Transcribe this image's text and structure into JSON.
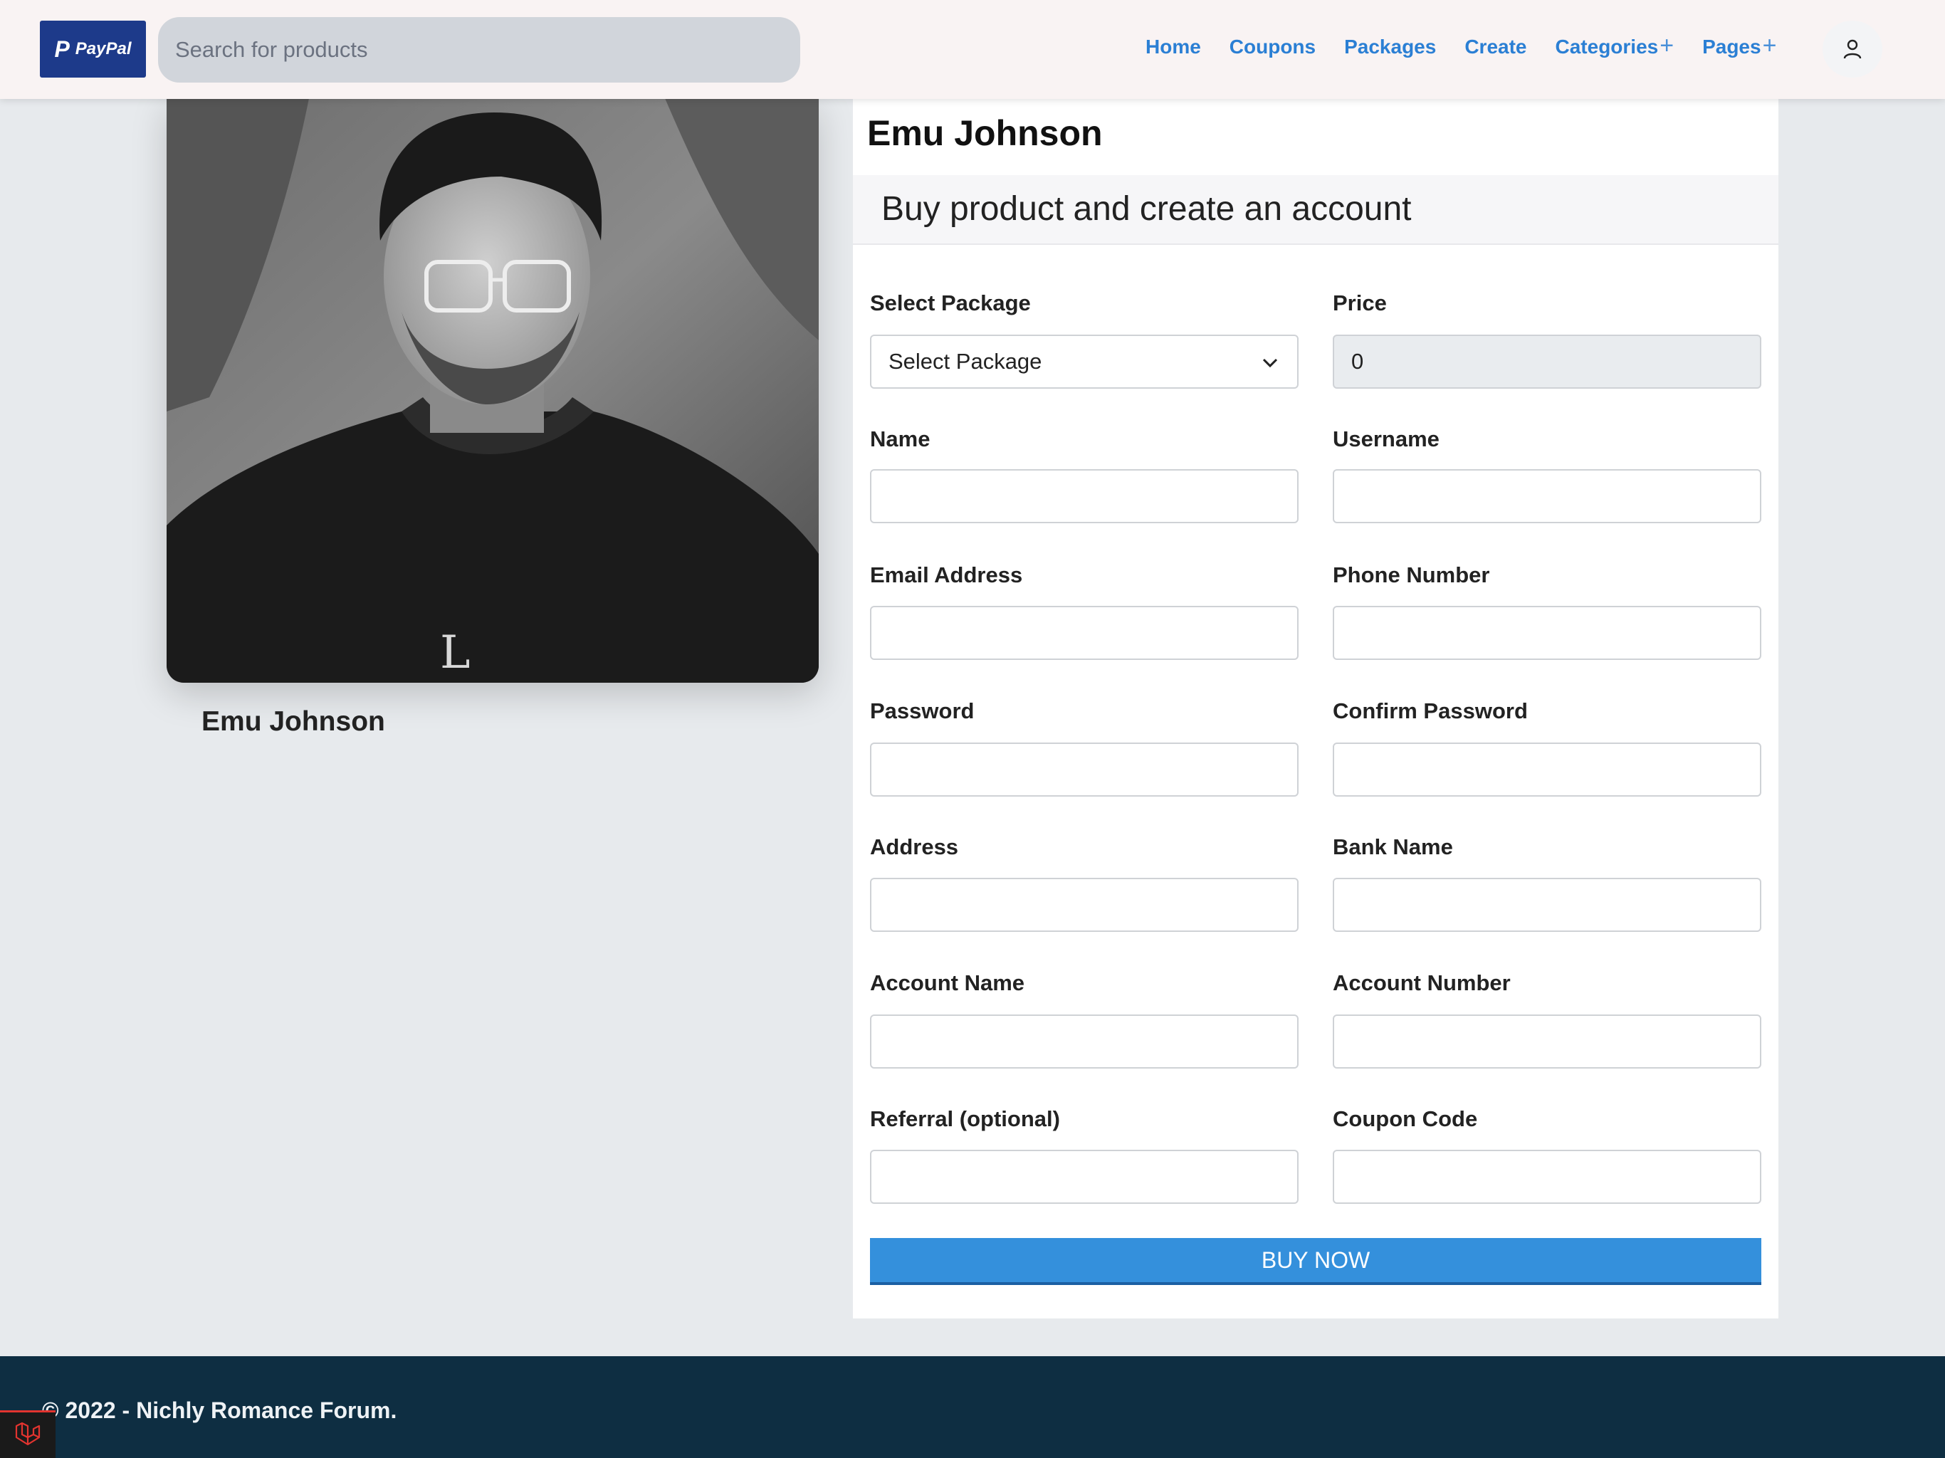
{
  "header": {
    "logo": {
      "mark": "P",
      "text": "PayPal"
    },
    "search": {
      "placeholder": "Search for products",
      "value": ""
    },
    "nav": [
      {
        "label": "Home"
      },
      {
        "label": "Coupons"
      },
      {
        "label": "Packages"
      },
      {
        "label": "Create"
      },
      {
        "label": "Categories",
        "has_plus": true
      },
      {
        "label": "Pages",
        "has_plus": true
      }
    ],
    "plus_glyph": "+",
    "user_icon": "user-icon"
  },
  "profile": {
    "name": "Emu Johnson"
  },
  "form": {
    "title": "Emu Johnson",
    "subtitle": "Buy product and create an account",
    "fields": [
      {
        "label": "Select Package",
        "type": "select",
        "value": "Select Package"
      },
      {
        "label": "Price",
        "type": "readonly",
        "value": "0"
      },
      {
        "label": "Name",
        "type": "text",
        "value": ""
      },
      {
        "label": "Username",
        "type": "text",
        "value": ""
      },
      {
        "label": "Email Address",
        "type": "text",
        "value": ""
      },
      {
        "label": "Phone Number",
        "type": "text",
        "value": ""
      },
      {
        "label": "Password",
        "type": "password",
        "value": ""
      },
      {
        "label": "Confirm Password",
        "type": "password",
        "value": ""
      },
      {
        "label": "Address",
        "type": "text",
        "value": ""
      },
      {
        "label": "Bank Name",
        "type": "text",
        "value": ""
      },
      {
        "label": "Account Name",
        "type": "text",
        "value": ""
      },
      {
        "label": "Account Number",
        "type": "text",
        "value": ""
      },
      {
        "label": "Referral (optional)",
        "type": "text",
        "value": ""
      },
      {
        "label": "Coupon Code",
        "type": "text",
        "value": ""
      }
    ],
    "submit_label": "BUY NOW"
  },
  "footer": {
    "text": "© 2022 - Nichly Romance Forum."
  },
  "colors": {
    "accent": "#3490dc",
    "nav_link": "#2b7fd4",
    "footer_bg": "#0e2e42",
    "logo_bg": "#1d3a8a"
  }
}
